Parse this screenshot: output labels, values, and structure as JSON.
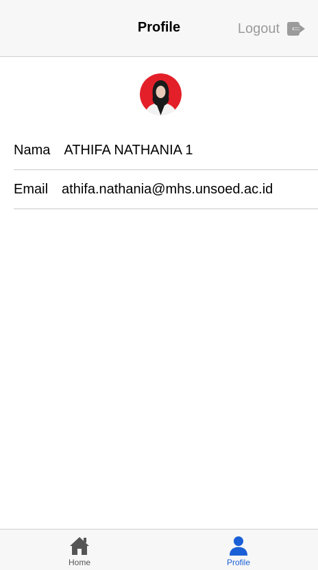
{
  "header": {
    "title": "Profile",
    "logout_label": "Logout",
    "logout_icon": "logout-icon"
  },
  "avatar": {
    "icon": "user-photo"
  },
  "profile": {
    "nama_label": "Nama",
    "nama_value": "ATHIFA NATHANIA 1",
    "email_label": "Email",
    "email_value": "athifa.nathania@mhs.unsoed.ac.id"
  },
  "tabbar": {
    "items": [
      {
        "label": "Home",
        "icon": "home-icon",
        "active": false
      },
      {
        "label": "Profile",
        "icon": "person-icon",
        "active": true
      }
    ]
  },
  "colors": {
    "accent": "#1a5fd6",
    "inactive": "#555555",
    "header_bg": "#f7f7f7",
    "logout": "#9b9b9b",
    "avatar_bg": "#e3202a"
  }
}
